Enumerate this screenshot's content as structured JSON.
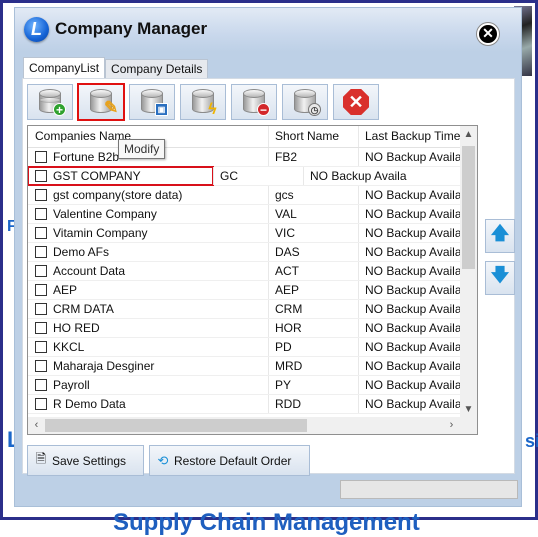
{
  "background": {
    "fragment_left_1": "Fi",
    "fragment_left_2": "L",
    "fragment_right": "sic",
    "fragment_bottom": "Supply Chain Management"
  },
  "window": {
    "title": "Company Manager",
    "logo_letter": "L",
    "close_icon": "close-circle-icon"
  },
  "tabs": [
    {
      "label": "CompanyList",
      "active": true
    },
    {
      "label": "Company Details",
      "active": false
    }
  ],
  "toolbar": {
    "buttons": [
      {
        "name": "add-company",
        "icon": "database-add-icon"
      },
      {
        "name": "modify-company",
        "icon": "database-edit-icon",
        "selected": true
      },
      {
        "name": "backup-company",
        "icon": "database-save-icon"
      },
      {
        "name": "restore-company",
        "icon": "database-lightning-icon"
      },
      {
        "name": "delete-company",
        "icon": "database-remove-icon"
      },
      {
        "name": "backup-history",
        "icon": "database-clock-icon"
      },
      {
        "name": "close-manager",
        "icon": "stop-close-icon"
      }
    ],
    "tooltip": "Modify"
  },
  "table": {
    "columns": [
      "Companies Name",
      "Short Name",
      "Last Backup Time"
    ],
    "rows": [
      {
        "name": "Fortune B2b",
        "short": "FB2",
        "backup": "NO Backup Available",
        "checked": false
      },
      {
        "name": "GST COMPANY",
        "short": "GC",
        "backup": "NO Backup Available",
        "checked": false,
        "highlighted": true
      },
      {
        "name": "gst company(store data)",
        "short": "gcs",
        "backup": "NO Backup Available",
        "checked": false
      },
      {
        "name": "Valentine Company",
        "short": "VAL",
        "backup": "NO Backup Available",
        "checked": false
      },
      {
        "name": "Vitamin Company",
        "short": "VIC",
        "backup": "NO Backup Available",
        "checked": false
      },
      {
        "name": "Demo AFs",
        "short": "DAS",
        "backup": "NO Backup Available",
        "checked": false
      },
      {
        "name": "Account Data",
        "short": "ACT",
        "backup": "NO Backup Available",
        "checked": false
      },
      {
        "name": "AEP",
        "short": "AEP",
        "backup": "NO Backup Available",
        "checked": false
      },
      {
        "name": "CRM DATA",
        "short": "CRM",
        "backup": "NO Backup Available",
        "checked": false
      },
      {
        "name": "HO RED",
        "short": "HOR",
        "backup": "NO Backup Available",
        "checked": false
      },
      {
        "name": "KKCL",
        "short": "PD",
        "backup": "NO Backup Available",
        "checked": false
      },
      {
        "name": "Maharaja Desginer",
        "short": "MRD",
        "backup": "NO Backup Available",
        "checked": false
      },
      {
        "name": "Payroll",
        "short": "PY",
        "backup": "NO Backup Available",
        "checked": false
      },
      {
        "name": "R Demo Data",
        "short": "RDD",
        "backup": "NO Backup Available",
        "checked": false
      }
    ]
  },
  "side_buttons": {
    "move_up_icon": "arrow-up-icon",
    "move_down_icon": "arrow-down-icon"
  },
  "footer": {
    "save_settings": "Save Settings",
    "restore_default_order": "Restore Default Order"
  }
}
